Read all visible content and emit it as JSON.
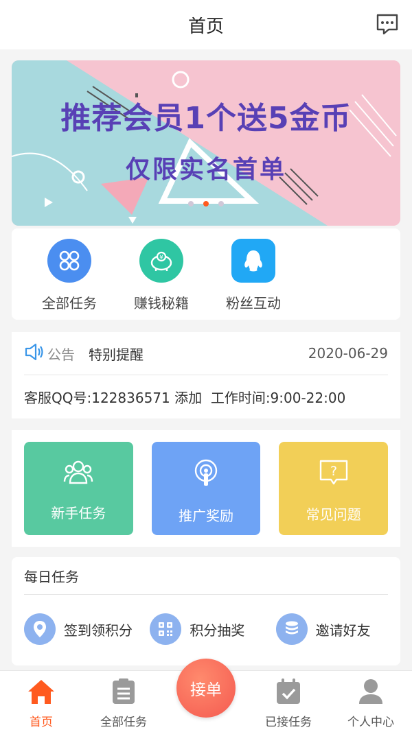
{
  "header": {
    "title": "首页",
    "message_icon": "chat-bubble-icon"
  },
  "banner": {
    "line1": "推荐会员1个送5金币",
    "line2": "仅限实名首单",
    "pages": 3,
    "active_page": 2,
    "colors": {
      "bg_teal": "#a8d9de",
      "bg_pink": "#f6c4d0",
      "text": "#5840b5"
    }
  },
  "quick_actions": [
    {
      "label": "全部任务",
      "icon": "grid-icon",
      "color": "#4b8ef0"
    },
    {
      "label": "赚钱秘籍",
      "icon": "piggy-bank-icon",
      "color": "#2fc6a3"
    },
    {
      "label": "粉丝互动",
      "icon": "qq-penguin-icon",
      "color": "#21a8f5"
    }
  ],
  "notice": {
    "tag": "公告",
    "title": "特别提醒",
    "date": "2020-06-29",
    "content": "客服QQ号:122836571 添加  工作时间:9:00-22:00"
  },
  "tiles": [
    {
      "label": "新手任务",
      "icon": "group-icon",
      "color": "#58c9a0"
    },
    {
      "label": "推广奖励",
      "icon": "broadcast-icon",
      "color": "#6ea3f5"
    },
    {
      "label": "常见问题",
      "icon": "question-icon",
      "color": "#f2cf57"
    }
  ],
  "daily": {
    "title": "每日任务",
    "items": [
      {
        "label": "签到领积分",
        "icon": "location-pin-icon"
      },
      {
        "label": "积分抽奖",
        "icon": "qr-code-icon"
      },
      {
        "label": "邀请好友",
        "icon": "coin-stack-icon"
      }
    ]
  },
  "tabbar": {
    "tabs": [
      {
        "label": "首页",
        "icon": "home-icon",
        "active": true
      },
      {
        "label": "全部任务",
        "icon": "clipboard-icon",
        "active": false
      },
      {
        "label": "已接任务",
        "icon": "calendar-check-icon",
        "active": false
      },
      {
        "label": "个人中心",
        "icon": "user-icon",
        "active": false
      }
    ],
    "center_button": "接单",
    "colors": {
      "active": "#ff5a1f",
      "inactive": "#9a9a9a"
    }
  }
}
